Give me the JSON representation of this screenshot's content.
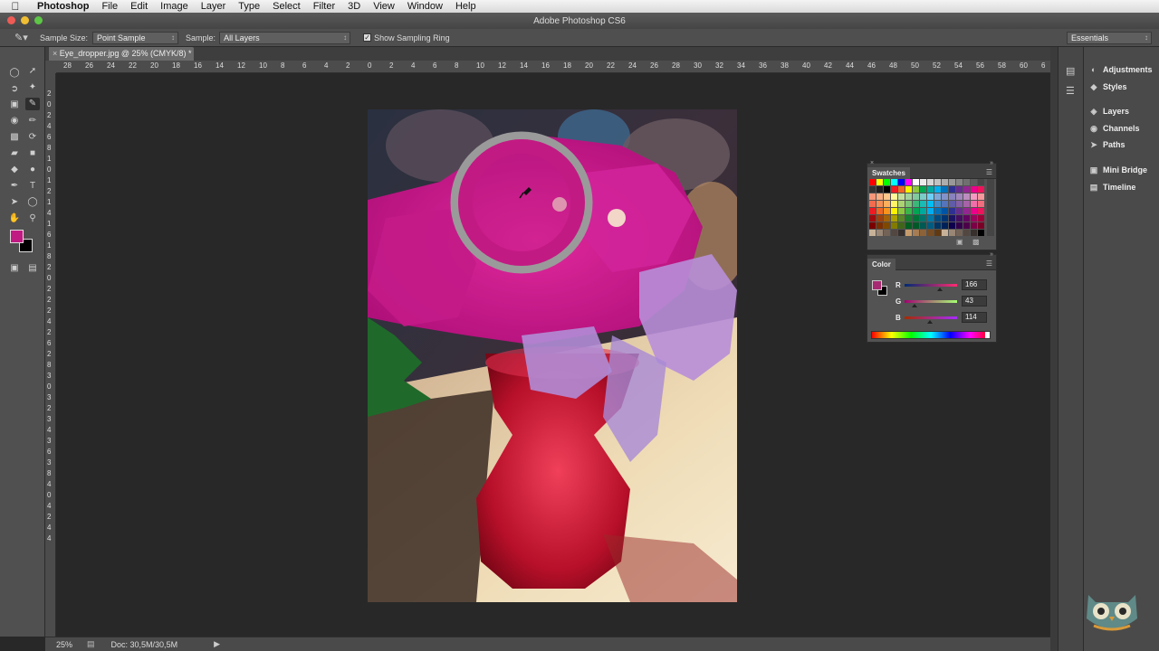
{
  "menubar": {
    "app": "Photoshop",
    "items": [
      "File",
      "Edit",
      "Image",
      "Layer",
      "Type",
      "Select",
      "Filter",
      "3D",
      "View",
      "Window",
      "Help"
    ]
  },
  "window": {
    "title": "Adobe Photoshop CS6"
  },
  "options": {
    "sample_size_label": "Sample Size:",
    "sample_size_value": "Point Sample",
    "sample_label": "Sample:",
    "sample_value": "All Layers",
    "show_ring_label": "Show Sampling Ring",
    "show_ring_checked": true,
    "workspace": "Essentials"
  },
  "document": {
    "tab_title": "Eye_dropper.jpg @ 25% (CMYK/8) *"
  },
  "rulers": {
    "h_ticks": [
      "28",
      "26",
      "24",
      "22",
      "20",
      "18",
      "16",
      "14",
      "12",
      "10",
      "8",
      "6",
      "4",
      "2",
      "0",
      "2",
      "4",
      "6",
      "8",
      "10",
      "12",
      "14",
      "16",
      "18",
      "20",
      "22",
      "24",
      "26",
      "28",
      "30",
      "32",
      "34",
      "36",
      "38",
      "40",
      "42",
      "44",
      "46",
      "48",
      "50",
      "52",
      "54",
      "56",
      "58",
      "60",
      "6"
    ],
    "v_ticks": [
      "2",
      "0",
      "2",
      "4",
      "6",
      "8",
      "1",
      "0",
      "1",
      "2",
      "1",
      "4",
      "1",
      "6",
      "1",
      "8",
      "2",
      "0",
      "2",
      "2",
      "2",
      "4",
      "2",
      "6",
      "2",
      "8",
      "3",
      "0",
      "3",
      "2",
      "3",
      "4",
      "3",
      "6",
      "3",
      "8",
      "4",
      "0",
      "4",
      "2",
      "4",
      "4"
    ]
  },
  "status": {
    "zoom": "25%",
    "doc": "Doc: 30,5M/30,5M"
  },
  "swatches": {
    "title": "Swatches"
  },
  "color_panel": {
    "title": "Color",
    "r_label": "R",
    "r_value": "166",
    "g_label": "G",
    "g_value": "43",
    "b_label": "B",
    "b_value": "114",
    "foreground": "#a62b72"
  },
  "dock": {
    "items": [
      "Adjustments",
      "Styles",
      "Layers",
      "Channels",
      "Paths",
      "Mini Bridge",
      "Timeline"
    ]
  },
  "colors": {
    "foreground": "#c21a83",
    "background": "#000000",
    "sampling_ring_outer": "#9a9a9a"
  }
}
